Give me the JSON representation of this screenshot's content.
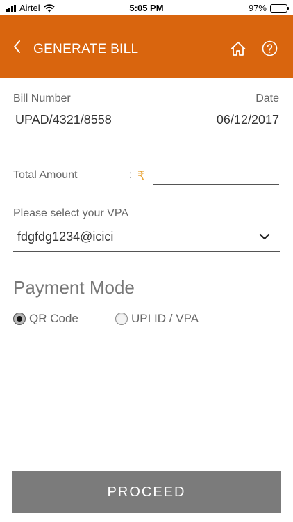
{
  "status_bar": {
    "carrier": "Airtel",
    "time": "5:05 PM",
    "battery": "97%"
  },
  "header": {
    "title": "GENERATE BILL",
    "icons": [
      "back-icon",
      "home-icon",
      "help-icon"
    ]
  },
  "form": {
    "bill_number_label": "Bill Number",
    "bill_number_value": "UPAD/4321/8558",
    "date_label": "Date",
    "date_value": "06/12/2017",
    "total_amount_label": "Total Amount",
    "amount_separator": ":",
    "currency_symbol": "₹",
    "total_amount_value": "",
    "vpa_label": "Please select your VPA",
    "vpa_value": "fdgfdg1234@icici"
  },
  "payment_mode": {
    "heading": "Payment Mode",
    "options": [
      {
        "label": "QR Code",
        "selected": true
      },
      {
        "label": "UPI ID / VPA",
        "selected": false
      }
    ]
  },
  "actions": {
    "proceed_label": "PROCEED"
  },
  "colors": {
    "header_bg": "#d9650e",
    "rupee": "#e8a53a",
    "proceed_bg": "#7b7b7b"
  }
}
